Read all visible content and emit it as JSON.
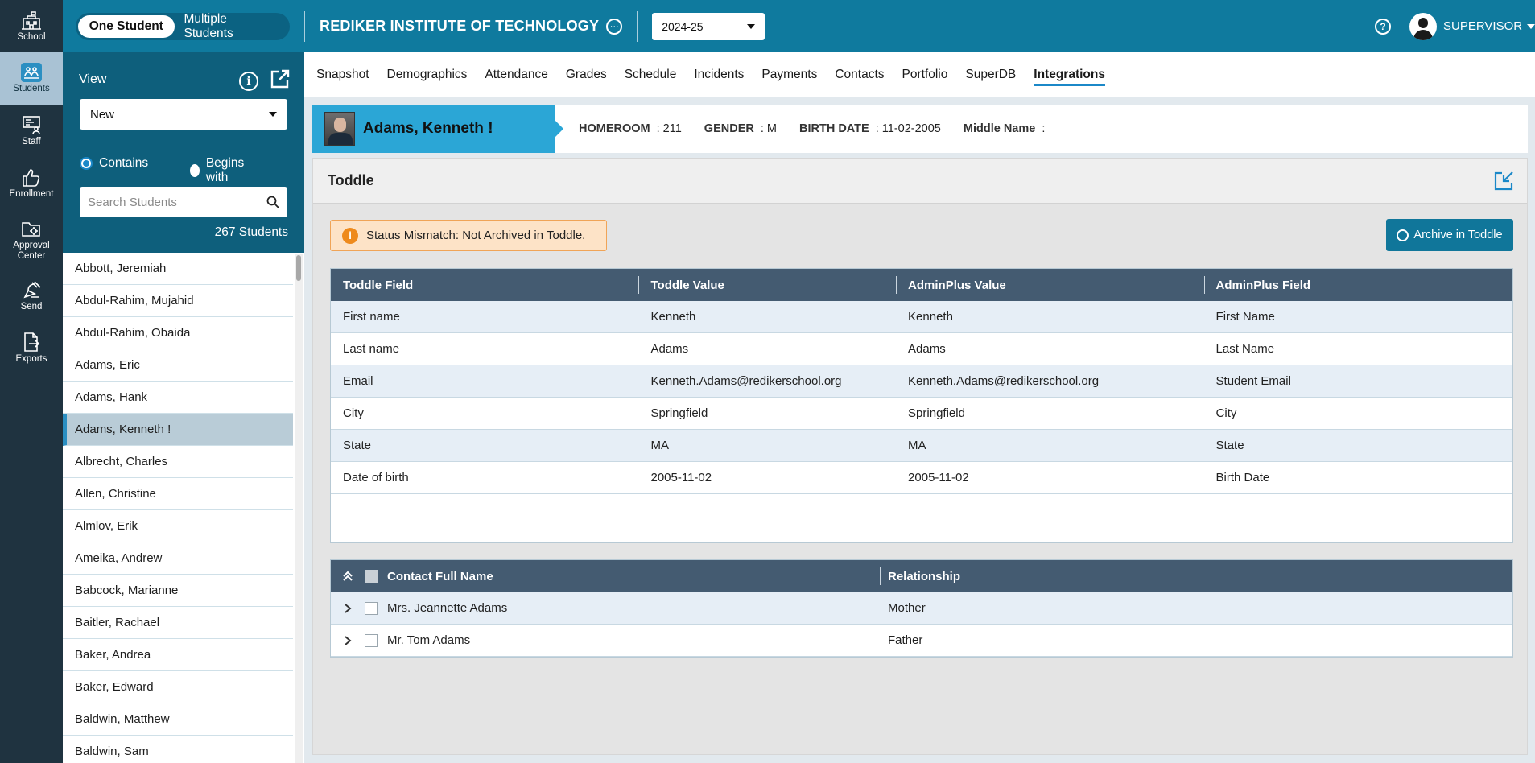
{
  "rail": [
    {
      "label": "School",
      "icon": "school-icon"
    },
    {
      "label": "Students",
      "icon": "students-icon",
      "active": true
    },
    {
      "label": "Staff",
      "icon": "staff-icon"
    },
    {
      "label": "Enrollment",
      "icon": "thumbs-up-icon"
    },
    {
      "label": "Approval Center",
      "icon": "folder-gear-icon"
    },
    {
      "label": "Send",
      "icon": "satellite-icon"
    },
    {
      "label": "Exports",
      "icon": "export-file-icon"
    }
  ],
  "topbar": {
    "seg_one": "One Student",
    "seg_multi": "Multiple Students",
    "institute": "REDIKER INSTITUTE OF TECHNOLOGY",
    "year": "2024-25",
    "user": "SUPERVISOR",
    "help": "?"
  },
  "panel": {
    "view_label": "View",
    "view_value": "New",
    "radio_contains": "Contains",
    "radio_begins": "Begins with",
    "search_placeholder": "Search Students",
    "count": "267 Students",
    "students": [
      "Abbott, Jeremiah",
      "Abdul-Rahim, Mujahid",
      "Abdul-Rahim, Obaida",
      "Adams, Eric",
      "Adams, Hank",
      "Adams, Kenneth !",
      "Albrecht, Charles",
      "Allen, Christine",
      "Almlov, Erik",
      "Ameika, Andrew",
      "Babcock, Marianne",
      "Baitler, Rachael",
      "Baker, Andrea",
      "Baker, Edward",
      "Baldwin, Matthew",
      "Baldwin, Sam"
    ],
    "selected_index": 5
  },
  "tabs": [
    "Snapshot",
    "Demographics",
    "Attendance",
    "Grades",
    "Schedule",
    "Incidents",
    "Payments",
    "Contacts",
    "Portfolio",
    "SuperDB",
    "Integrations"
  ],
  "active_tab": "Integrations",
  "student": {
    "name": "Adams, Kenneth !",
    "homeroom_label": "HOMEROOM",
    "homeroom_value": ": 211",
    "gender_label": "GENDER",
    "gender_value": ": M",
    "birth_label": "BIRTH DATE",
    "birth_value": ": 11-02-2005",
    "middle_label": "Middle Name",
    "middle_value": ":"
  },
  "card": {
    "title": "Toddle",
    "alert": "Status Mismatch: Not Archived in Toddle.",
    "archive_button": "Archive in Toddle"
  },
  "fields_table": {
    "headers": [
      "Toddle Field",
      "Toddle Value",
      "AdminPlus Value",
      "AdminPlus Field"
    ],
    "rows": [
      [
        "First name",
        "Kenneth",
        "Kenneth",
        "First Name"
      ],
      [
        "Last name",
        "Adams",
        "Adams",
        "Last Name"
      ],
      [
        "Email",
        "Kenneth.Adams@redikerschool.org",
        "Kenneth.Adams@redikerschool.org",
        "Student Email"
      ],
      [
        "City",
        "Springfield",
        "Springfield",
        "City"
      ],
      [
        "State",
        "MA",
        "MA",
        "State"
      ],
      [
        "Date of birth",
        "2005-11-02",
        "2005-11-02",
        "Birth Date"
      ]
    ]
  },
  "contacts_table": {
    "headers": [
      "Contact Full Name",
      "Relationship"
    ],
    "rows": [
      [
        "Mrs. Jeannette Adams",
        "Mother"
      ],
      [
        "Mr. Tom Adams",
        "Father"
      ]
    ]
  }
}
